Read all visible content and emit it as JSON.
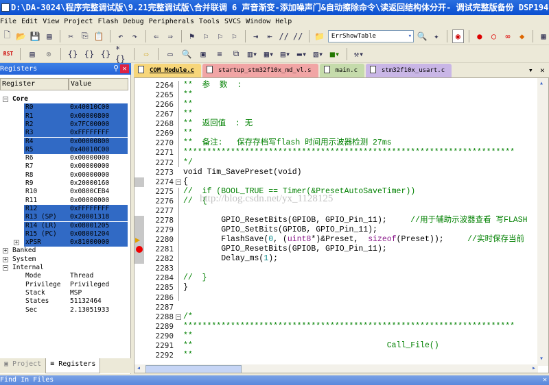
{
  "title": "D:\\DA-3024\\程序完整调试版\\9.21完整调试版\\合并联调 6 声音渐变-添加噪声门&自动擦除命令\\读返回结构体分开- 调试完整版备份 DSP194",
  "menu": [
    "File",
    "Edit",
    "View",
    "Project",
    "Flash",
    "Debug",
    "Peripherals",
    "Tools",
    "SVCS",
    "Window",
    "Help"
  ],
  "toolbar": {
    "target_combo": "ErrShowTable",
    "reset_label": "RST"
  },
  "registers_panel": {
    "title": "Registers",
    "col_register": "Register",
    "col_value": "Value",
    "rows": [
      {
        "name": "Core",
        "value": "",
        "type": "group",
        "expanded": true
      },
      {
        "name": "R0",
        "value": "0x40010C00",
        "sel": true
      },
      {
        "name": "R1",
        "value": "0x00000800",
        "sel": true
      },
      {
        "name": "R2",
        "value": "0x7FC00000",
        "sel": true
      },
      {
        "name": "R3",
        "value": "0xFFFFFFFF",
        "sel": true
      },
      {
        "name": "R4",
        "value": "0x00000800",
        "sel": true
      },
      {
        "name": "R5",
        "value": "0x40010C00",
        "sel": true
      },
      {
        "name": "R6",
        "value": "0x00000000"
      },
      {
        "name": "R7",
        "value": "0x00000000"
      },
      {
        "name": "R8",
        "value": "0x00000000"
      },
      {
        "name": "R9",
        "value": "0x20000160"
      },
      {
        "name": "R10",
        "value": "0x0800CEB4"
      },
      {
        "name": "R11",
        "value": "0x00000000"
      },
      {
        "name": "R12",
        "value": "0xFFFFFFFF",
        "sel": true
      },
      {
        "name": "R13 (SP)",
        "value": "0x20001318",
        "sel": true
      },
      {
        "name": "R14 (LR)",
        "value": "0x08001205",
        "sel": true
      },
      {
        "name": "R15 (PC)",
        "value": "0x08001204",
        "sel": true
      },
      {
        "name": "xPSR",
        "value": "0x81000000",
        "sel": true,
        "plus": true
      },
      {
        "name": "Banked",
        "value": "",
        "type": "group2"
      },
      {
        "name": "System",
        "value": "",
        "type": "group2"
      },
      {
        "name": "Internal",
        "value": "",
        "type": "group2",
        "expanded": true
      },
      {
        "name": "Mode",
        "value": "Thread"
      },
      {
        "name": "Privilege",
        "value": "Privileged"
      },
      {
        "name": "Stack",
        "value": "MSP"
      },
      {
        "name": "States",
        "value": "51132464"
      },
      {
        "name": "Sec",
        "value": "2.13051933"
      }
    ]
  },
  "bottom_tabs": [
    "Project",
    "Registers"
  ],
  "find_bar": "Find In Files",
  "tabs": [
    {
      "label": "COM_Module.c",
      "color": "#f7d67a",
      "active": true
    },
    {
      "label": "startup_stm32f10x_md_vl.s",
      "color": "#f1a5a5"
    },
    {
      "label": "main.c",
      "color": "#c5dbab"
    },
    {
      "label": "stm32f10x_usart.c",
      "color": "#c9b6e6"
    }
  ],
  "watermark": "http://blog.csdn.net/yx_1128125",
  "code": [
    {
      "n": "2264",
      "s": [
        [
          "cm",
          "**  参  数  :"
        ]
      ]
    },
    {
      "n": "2265",
      "s": [
        [
          "cm",
          "**"
        ]
      ]
    },
    {
      "n": "2266",
      "s": [
        [
          "cm",
          "**"
        ]
      ]
    },
    {
      "n": "2267",
      "s": [
        [
          "cm",
          "**"
        ]
      ]
    },
    {
      "n": "2268",
      "s": [
        [
          "cm",
          "**  返回值  : 无"
        ]
      ]
    },
    {
      "n": "2269",
      "s": [
        [
          "cm",
          "**"
        ]
      ]
    },
    {
      "n": "2270",
      "s": [
        [
          "cm",
          "**  备注:   保存存档写flash 时间用示波器检测 27ms"
        ]
      ]
    },
    {
      "n": "2271",
      "s": [
        [
          "cm",
          "**********************************************************************"
        ]
      ]
    },
    {
      "n": "2272",
      "s": [
        [
          "cm",
          "*/"
        ]
      ]
    },
    {
      "n": "2273",
      "s": [
        [
          "tx",
          "void Tim_SavePreset(void)"
        ]
      ]
    },
    {
      "n": "2274",
      "s": [
        [
          "tx",
          "{"
        ]
      ]
    },
    {
      "n": "2275",
      "s": [
        [
          "cm",
          "//  if (BOOL_TRUE == Timer(&PresetAutoSaveTimer))"
        ]
      ]
    },
    {
      "n": "2276",
      "s": [
        [
          "cm",
          "//  {"
        ]
      ]
    },
    {
      "n": "2277",
      "s": []
    },
    {
      "n": "2278",
      "s": [
        [
          "tx",
          "        GPIO_ResetBits(GPIOB, GPIO_Pin_11);     "
        ],
        [
          "cm",
          "//用于辅助示波器查看 写FLASH"
        ]
      ]
    },
    {
      "n": "2279",
      "s": [
        [
          "tx",
          "        GPIO_SetBits(GPIOB, GPIO_Pin_11);"
        ]
      ]
    },
    {
      "n": "2280",
      "s": [
        [
          "tx",
          "        FlashSave("
        ],
        [
          "num",
          "0"
        ],
        [
          "tx",
          ", ("
        ],
        [
          "ty",
          "uint8"
        ],
        [
          "tx",
          "*)&Preset,  "
        ],
        [
          "ty",
          "sizeof"
        ],
        [
          "tx",
          "(Preset));     "
        ],
        [
          "cm",
          "//实时保存当前"
        ]
      ]
    },
    {
      "n": "2281",
      "s": [
        [
          "tx",
          "        GPIO_ResetBits(GPIOB, GPIO_Pin_11);"
        ]
      ]
    },
    {
      "n": "2282",
      "s": [
        [
          "tx",
          "        Delay_ms("
        ],
        [
          "num",
          "1"
        ],
        [
          "tx",
          ");"
        ]
      ]
    },
    {
      "n": "2283",
      "s": []
    },
    {
      "n": "2284",
      "s": [
        [
          "cm",
          "//  }"
        ]
      ]
    },
    {
      "n": "2285",
      "s": [
        [
          "tx",
          "}"
        ]
      ]
    },
    {
      "n": "2286",
      "s": []
    },
    {
      "n": "2287",
      "s": []
    },
    {
      "n": "2288",
      "s": [
        [
          "cm",
          "/*"
        ]
      ]
    },
    {
      "n": "2289",
      "s": [
        [
          "cm",
          "**********************************************************************"
        ]
      ]
    },
    {
      "n": "2290",
      "s": [
        [
          "cm",
          "**"
        ]
      ]
    },
    {
      "n": "2291",
      "s": [
        [
          "cm",
          "**                                         Call_File()"
        ]
      ]
    },
    {
      "n": "2292",
      "s": [
        [
          "cm",
          "**"
        ]
      ]
    }
  ],
  "markers": {
    "current_line": "2280",
    "breakpoint_line": "2281"
  }
}
